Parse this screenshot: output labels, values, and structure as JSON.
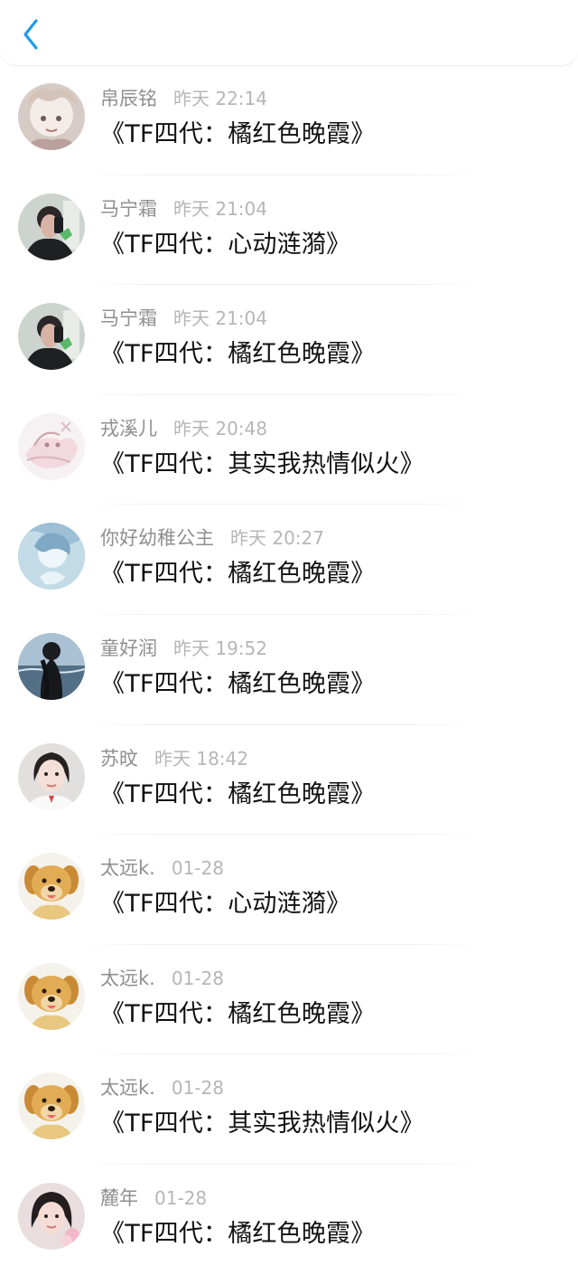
{
  "header": {
    "back_icon": "chevron-left-icon",
    "accent_color": "#1e9be8"
  },
  "items": [
    {
      "username": "帛辰铭",
      "time": "昨天 22:14",
      "song": "《TF四代：橘红色晚霞》",
      "avatar": "anime-girl-avatar"
    },
    {
      "username": "马宁霜",
      "time": "昨天 21:04",
      "song": "《TF四代：心动涟漪》",
      "avatar": "girl-selfie-avatar"
    },
    {
      "username": "马宁霜",
      "time": "昨天 21:04",
      "song": "《TF四代：橘红色晚霞》",
      "avatar": "girl-selfie-avatar"
    },
    {
      "username": "戎溪儿",
      "time": "昨天 20:48",
      "song": "《TF四代：其实我热情似火》",
      "avatar": "pink-sketch-avatar"
    },
    {
      "username": "你好幼稚公主",
      "time": "昨天 20:27",
      "song": "《TF四代：橘红色晚霞》",
      "avatar": "blue-anime-avatar"
    },
    {
      "username": "童好润",
      "time": "昨天 19:52",
      "song": "《TF四代：橘红色晚霞》",
      "avatar": "ocean-silhouette-avatar"
    },
    {
      "username": "苏旼",
      "time": "昨天 18:42",
      "song": "《TF四代：橘红色晚霞》",
      "avatar": "girl-portrait-avatar"
    },
    {
      "username": "太远k.",
      "time": "01-28",
      "song": "《TF四代：心动涟漪》",
      "avatar": "golden-puppy-avatar"
    },
    {
      "username": "太远k.",
      "time": "01-28",
      "song": "《TF四代：橘红色晚霞》",
      "avatar": "golden-puppy-avatar"
    },
    {
      "username": "太远k.",
      "time": "01-28",
      "song": "《TF四代：其实我热情似火》",
      "avatar": "golden-puppy-avatar"
    },
    {
      "username": "麓年",
      "time": "01-28",
      "song": "《TF四代：橘红色晚霞》",
      "avatar": "girl-flower-avatar"
    }
  ]
}
